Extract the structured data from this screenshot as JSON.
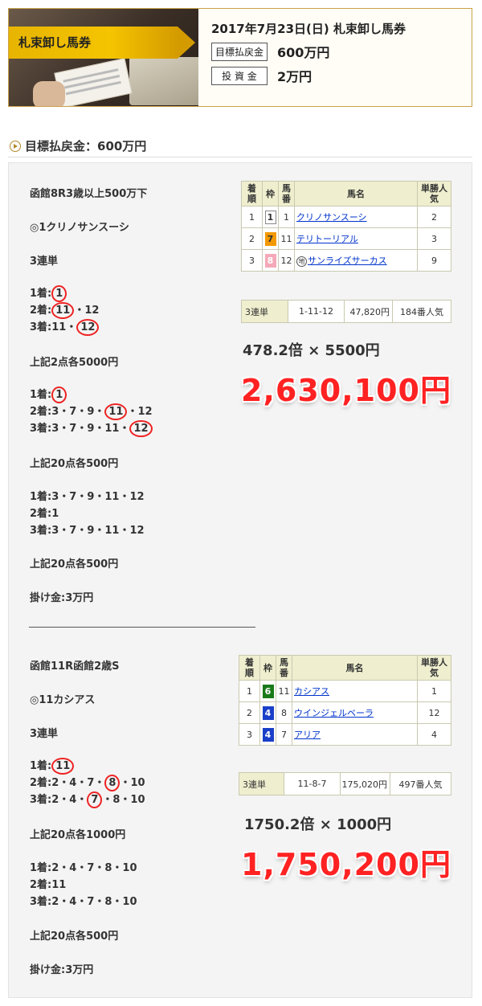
{
  "header": {
    "banner_label": "札束卸し馬券",
    "title": "2017年7月23日(日)  札束卸し馬券",
    "target_label": "目標払戻金",
    "target_value": "600万円",
    "invest_label": "投 資 金",
    "invest_value": "2万円"
  },
  "section": {
    "title": "目標払戻金：600万円"
  },
  "race1": {
    "name": "函館8R3歳以上500万下",
    "pick": "◎1クリノサンスーシ",
    "type": "3連単",
    "lines": [
      {
        "pre": "1着:",
        "circ": "1",
        "post": ""
      },
      {
        "pre": "2着:",
        "circ": "11",
        "post": "・12"
      },
      {
        "pre": "3着:11・",
        "circ": "12",
        "post": ""
      }
    ],
    "note1": "上記2点各5000円",
    "lines2": [
      {
        "pre": "1着:",
        "circ": "1",
        "post": ""
      },
      {
        "pre": "2着:3・7・9・",
        "circ": "11",
        "post": "・12"
      },
      {
        "pre": "3着:3・7・9・11・",
        "circ": "12",
        "post": ""
      }
    ],
    "note2": "上記20点各500円",
    "lines3": [
      "1着:3・7・9・11・12",
      "2着:1",
      "3着:3・7・9・11・12"
    ],
    "note3": "上記20点各500円",
    "bet": "掛け金:3万円",
    "table_head": [
      "着順",
      "枠",
      "馬番",
      "馬名",
      "単勝人気"
    ],
    "rows": [
      {
        "pos": "1",
        "waku": "1",
        "num": "1",
        "name": "クリノサンスーシ",
        "pop": "2",
        "mark": ""
      },
      {
        "pos": "2",
        "waku": "7",
        "num": "11",
        "name": "テリトーリアル",
        "pop": "3",
        "mark": ""
      },
      {
        "pos": "3",
        "waku": "8",
        "num": "12",
        "name": "サンライズサーカス",
        "pop": "9",
        "mark": "地"
      }
    ],
    "payout": {
      "type": "3連単",
      "combo": "1-11-12",
      "amount": "47,820円",
      "rank": "184番人気"
    },
    "mult": "478.2倍 × 5500円",
    "big": "2,630,100円"
  },
  "race2": {
    "name": "函館11R函館2歳S",
    "pick": "◎11カシアス",
    "type": "3連単",
    "lines": [
      {
        "pre": "1着:",
        "circ": "11",
        "post": ""
      },
      {
        "pre": "2着:2・4・7・",
        "circ": "8",
        "post": "・10"
      },
      {
        "pre": "3着:2・4・",
        "circ": "7",
        "post": "・8・10"
      }
    ],
    "note1": "上記20点各1000円",
    "lines2": [
      "1着:2・4・7・8・10",
      "2着:11",
      "3着:2・4・7・8・10"
    ],
    "note2": "上記20点各500円",
    "bet": "掛け金:3万円",
    "rows": [
      {
        "pos": "1",
        "waku": "6",
        "num": "11",
        "name": "カシアス",
        "pop": "1"
      },
      {
        "pos": "2",
        "waku": "4",
        "num": "8",
        "name": "ウインジェルベーラ",
        "pop": "12"
      },
      {
        "pos": "3",
        "waku": "4",
        "num": "7",
        "name": "アリア",
        "pop": "4"
      }
    ],
    "payout": {
      "type": "3連単",
      "combo": "11-8-7",
      "amount": "175,020円",
      "rank": "497番人気"
    },
    "mult": "1750.2倍 × 1000円",
    "big": "1,750,200円"
  },
  "colors": {
    "accent": "#f22",
    "gold": "#e7b400",
    "border": "#c9a24a"
  }
}
